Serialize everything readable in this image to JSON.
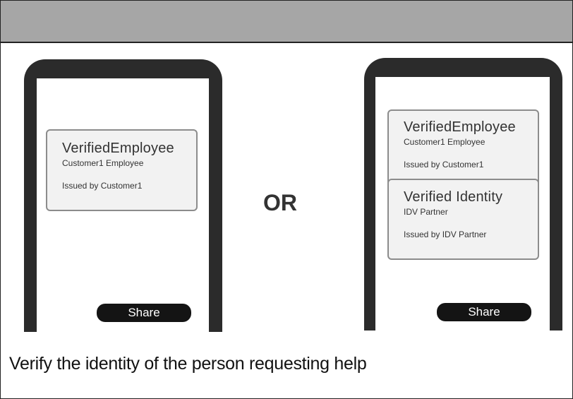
{
  "left_phone": {
    "card": {
      "title": "VerifiedEmployee",
      "subtitle": "Customer1 Employee",
      "issuer": "Issued by Customer1"
    },
    "share_label": "Share"
  },
  "separator": {
    "label": "OR"
  },
  "right_phone": {
    "cards": [
      {
        "title": "VerifiedEmployee",
        "subtitle": "Customer1 Employee",
        "issuer": "Issued by Customer1"
      },
      {
        "title": "Verified Identity",
        "subtitle": "IDV Partner",
        "issuer": "Issued by IDV Partner"
      }
    ],
    "share_label": "Share"
  },
  "caption": "Verify the identity of the person requesting help",
  "colors": {
    "header_bar": "#a6a6a6",
    "phone_body": "#2b2b2b",
    "card_fill": "#f2f2f2",
    "card_border": "#8c8c8c",
    "share_button": "#141414"
  }
}
